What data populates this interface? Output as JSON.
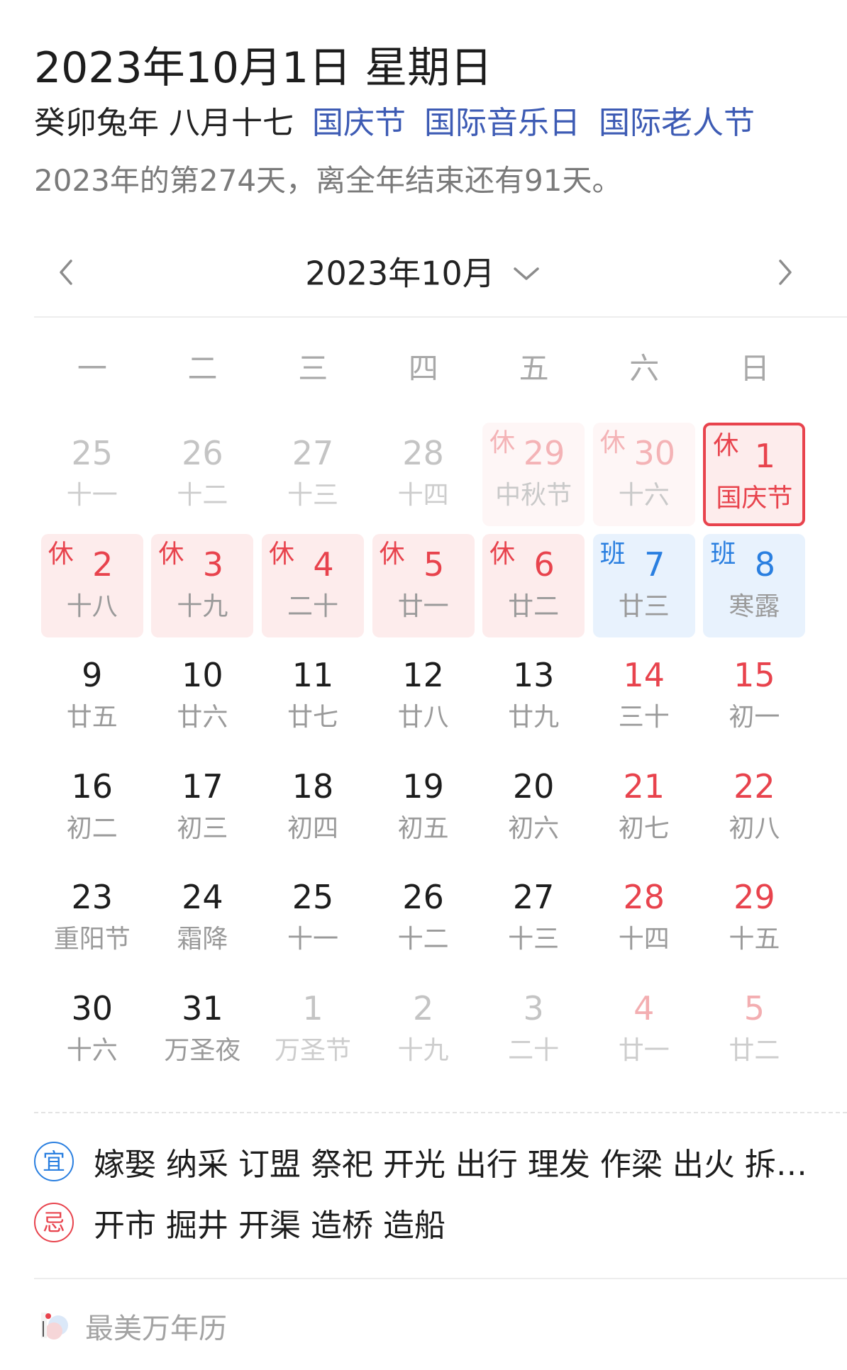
{
  "header": {
    "date_title": "2023年10月1日 星期日",
    "lunar": "癸卯兔年 八月十七",
    "festivals": [
      "国庆节",
      "国际音乐日",
      "国际老人节"
    ],
    "day_count": "2023年的第274天，离全年结束还有91天。"
  },
  "month_nav": {
    "label": "2023年10月",
    "prev_icon": "chevron-left-icon",
    "next_icon": "chevron-right-icon",
    "dropdown_icon": "chevron-down-icon"
  },
  "weekdays": [
    "一",
    "二",
    "三",
    "四",
    "五",
    "六",
    "日"
  ],
  "weeks": [
    [
      {
        "day": "25",
        "lunar": "十一",
        "other": true
      },
      {
        "day": "26",
        "lunar": "十二",
        "other": true
      },
      {
        "day": "27",
        "lunar": "十三",
        "other": true
      },
      {
        "day": "28",
        "lunar": "十四",
        "other": true
      },
      {
        "day": "29",
        "lunar": "中秋节",
        "other": true,
        "tag": "休",
        "status": "rest"
      },
      {
        "day": "30",
        "lunar": "十六",
        "other": true,
        "tag": "休",
        "status": "rest"
      },
      {
        "day": "1",
        "lunar": "国庆节",
        "tag": "休",
        "status": "rest",
        "selected": true
      }
    ],
    [
      {
        "day": "2",
        "lunar": "十八",
        "tag": "休",
        "status": "rest"
      },
      {
        "day": "3",
        "lunar": "十九",
        "tag": "休",
        "status": "rest"
      },
      {
        "day": "4",
        "lunar": "二十",
        "tag": "休",
        "status": "rest"
      },
      {
        "day": "5",
        "lunar": "廿一",
        "tag": "休",
        "status": "rest"
      },
      {
        "day": "6",
        "lunar": "廿二",
        "tag": "休",
        "status": "rest"
      },
      {
        "day": "7",
        "lunar": "廿三",
        "tag": "班",
        "status": "work"
      },
      {
        "day": "8",
        "lunar": "寒露",
        "tag": "班",
        "status": "work"
      }
    ],
    [
      {
        "day": "9",
        "lunar": "廿五"
      },
      {
        "day": "10",
        "lunar": "廿六"
      },
      {
        "day": "11",
        "lunar": "廿七"
      },
      {
        "day": "12",
        "lunar": "廿八"
      },
      {
        "day": "13",
        "lunar": "廿九"
      },
      {
        "day": "14",
        "lunar": "三十",
        "weekend": true
      },
      {
        "day": "15",
        "lunar": "初一",
        "weekend": true
      }
    ],
    [
      {
        "day": "16",
        "lunar": "初二"
      },
      {
        "day": "17",
        "lunar": "初三"
      },
      {
        "day": "18",
        "lunar": "初四"
      },
      {
        "day": "19",
        "lunar": "初五"
      },
      {
        "day": "20",
        "lunar": "初六"
      },
      {
        "day": "21",
        "lunar": "初七",
        "weekend": true
      },
      {
        "day": "22",
        "lunar": "初八",
        "weekend": true
      }
    ],
    [
      {
        "day": "23",
        "lunar": "重阳节"
      },
      {
        "day": "24",
        "lunar": "霜降"
      },
      {
        "day": "25",
        "lunar": "十一"
      },
      {
        "day": "26",
        "lunar": "十二"
      },
      {
        "day": "27",
        "lunar": "十三"
      },
      {
        "day": "28",
        "lunar": "十四",
        "weekend": true
      },
      {
        "day": "29",
        "lunar": "十五",
        "weekend": true
      }
    ],
    [
      {
        "day": "30",
        "lunar": "十六"
      },
      {
        "day": "31",
        "lunar": "万圣夜"
      },
      {
        "day": "1",
        "lunar": "万圣节",
        "other": true
      },
      {
        "day": "2",
        "lunar": "十九",
        "other": true
      },
      {
        "day": "3",
        "lunar": "二十",
        "other": true
      },
      {
        "day": "4",
        "lunar": "廿一",
        "other": true,
        "weekend": true
      },
      {
        "day": "5",
        "lunar": "廿二",
        "other": true,
        "weekend": true
      }
    ]
  ],
  "almanac": {
    "yi_badge": "宜",
    "yi_text": "嫁娶 纳采 订盟 祭祀 开光 出行 理发 作梁 出火 拆卸 修造",
    "ji_badge": "忌",
    "ji_text": "开市 掘井 开渠 造桥 造船"
  },
  "footer": {
    "brand": "最美万年历",
    "logo_icon": "app-logo-icon"
  },
  "colors": {
    "accent_red": "#e8434d",
    "accent_blue": "#2a7fe0",
    "festival_blue": "#3d5bb4"
  }
}
